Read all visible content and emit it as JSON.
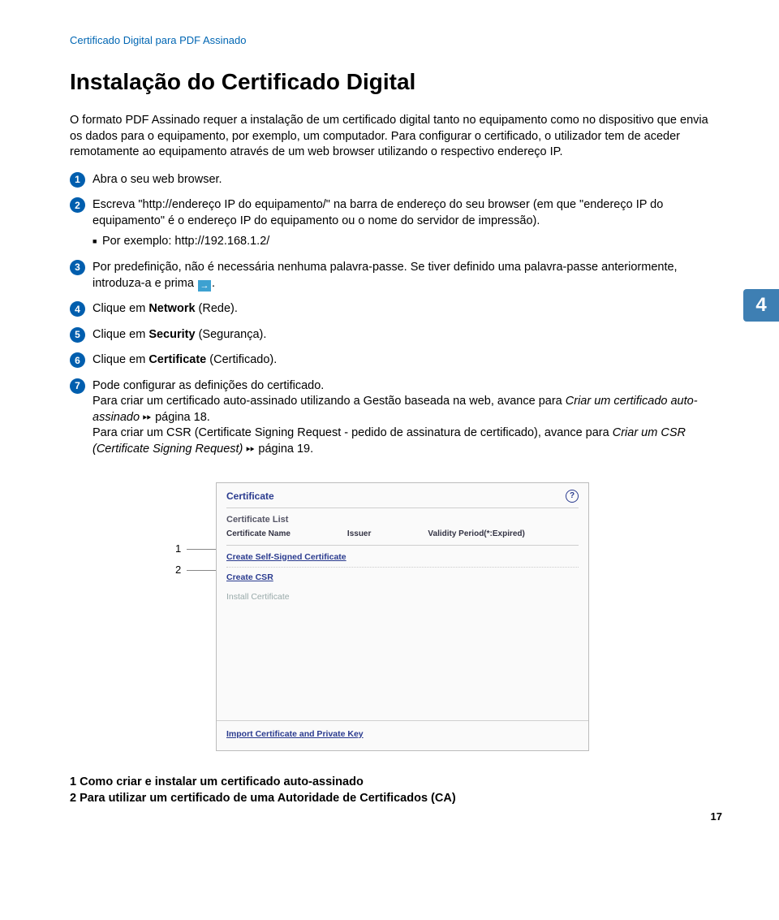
{
  "breadcrumb": "Certificado Digital para PDF Assinado",
  "title": "Instalação do Certificado Digital",
  "intro": "O formato PDF Assinado requer a instalação de um certificado digital tanto no equipamento como no dispositivo que envia os dados para o equipamento, por exemplo, um computador. Para configurar o certificado, o utilizador tem de aceder remotamente ao equipamento através de um web browser utilizando o respectivo endereço IP.",
  "side_tab": "4",
  "steps": {
    "s1": "Abra o seu web browser.",
    "s2": "Escreva \"http://endereço IP do equipamento/\" na barra de endereço do seu browser (em que \"endereço IP do equipamento\" é o endereço IP do equipamento ou o nome do servidor de impressão).",
    "s2_sub": "Por exemplo: http://192.168.1.2/",
    "s3_a": "Por predefinição, não é necessária nenhuma palavra-passe. Se tiver definido uma palavra-passe anteriormente, introduza-a e prima ",
    "s3_b": ".",
    "s4_a": "Clique em ",
    "s4_b": "Network",
    "s4_c": " (Rede).",
    "s5_a": "Clique em ",
    "s5_b": "Security",
    "s5_c": " (Segurança).",
    "s6_a": "Clique em ",
    "s6_b": "Certificate",
    "s6_c": " (Certificado).",
    "s7_a": "Pode configurar as definições do certificado.",
    "s7_b": "Para criar um certificado auto-assinado utilizando a Gestão baseada na web, avance para ",
    "s7_c": "Criar um certificado auto-assinado",
    "s7_d": " página 18.",
    "s7_e": "Para criar um CSR (Certificate Signing Request - pedido de assinatura de certificado), avance para ",
    "s7_f": "Criar um CSR (Certificate Signing Request)",
    "s7_g": " página 19."
  },
  "callouts": {
    "c1": "1",
    "c2": "2"
  },
  "panel": {
    "title": "Certificate",
    "list_title": "Certificate List",
    "col1": "Certificate Name",
    "col2": "Issuer",
    "col3": "Validity Period(*:Expired)",
    "link1": "Create Self-Signed Certificate",
    "link2": "Create CSR",
    "link3": "Install Certificate",
    "footer": "Import Certificate and Private Key"
  },
  "legend": {
    "l1": "1  Como criar e instalar um certificado auto-assinado",
    "l2": "2  Para utilizar um certificado de uma Autoridade de Certificados (CA)"
  },
  "page_number": "17"
}
